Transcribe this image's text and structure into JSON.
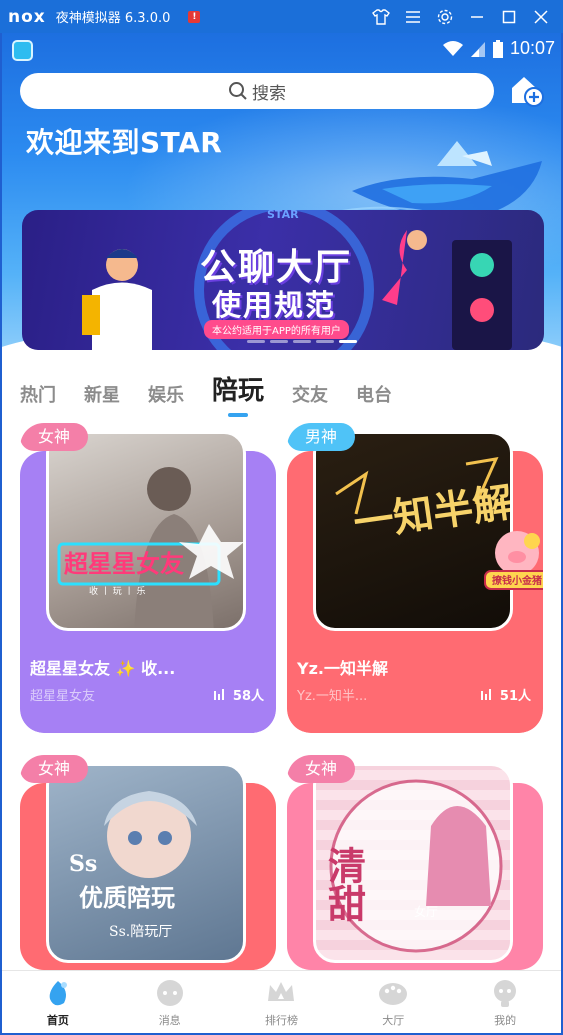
{
  "emulator": {
    "logo": "nox",
    "title": "夜神模拟器 6.3.0.0"
  },
  "status_bar": {
    "time": "10:07"
  },
  "search": {
    "placeholder": "搜索"
  },
  "welcome": "欢迎来到STAR",
  "banner": {
    "title": "公聊大厅",
    "subtitle": "使用规范",
    "tagline": "本公约适用于APP的所有用户",
    "logo_text": "STAR"
  },
  "tabs": [
    "热门",
    "新星",
    "娱乐",
    "陪玩",
    "交友",
    "电台"
  ],
  "active_tab": "陪玩",
  "cards": [
    {
      "badge": "女神",
      "badge_color": "#f47fa8",
      "bg_color": "#a680f4",
      "name": "超星星女友 ✨ 收...",
      "sub": "超星星女友",
      "count": "58人",
      "art_text": "超星星女友",
      "art_sub": "收 丨 玩 丨 乐"
    },
    {
      "badge": "男神",
      "badge_color": "#4fc3f7",
      "bg_color": "#ff6b72",
      "name": "Yz.一知半解",
      "sub": "Yz.一知半...",
      "count": "51人",
      "art_text": "一知半解",
      "art_sticker": "撩钱小金猪"
    },
    {
      "badge": "女神",
      "badge_color": "#f47fa8",
      "bg_color": "#ff6b72",
      "name": "",
      "sub": "",
      "count": "",
      "art_text": "优质陪玩",
      "art_sub": "Ss.陪玩厅",
      "art_top": "Ss"
    },
    {
      "badge": "女神",
      "badge_color": "#f47fa8",
      "bg_color": "#ff84a8",
      "name": "",
      "sub": "",
      "count": "",
      "art_text": "清甜",
      "art_sub": "女厅"
    }
  ],
  "bottom_nav": [
    {
      "label": "首页",
      "icon": "home-icon"
    },
    {
      "label": "消息",
      "icon": "message-icon"
    },
    {
      "label": "排行榜",
      "icon": "crown-icon"
    },
    {
      "label": "大厅",
      "icon": "hall-icon"
    },
    {
      "label": "我的",
      "icon": "profile-icon"
    }
  ]
}
